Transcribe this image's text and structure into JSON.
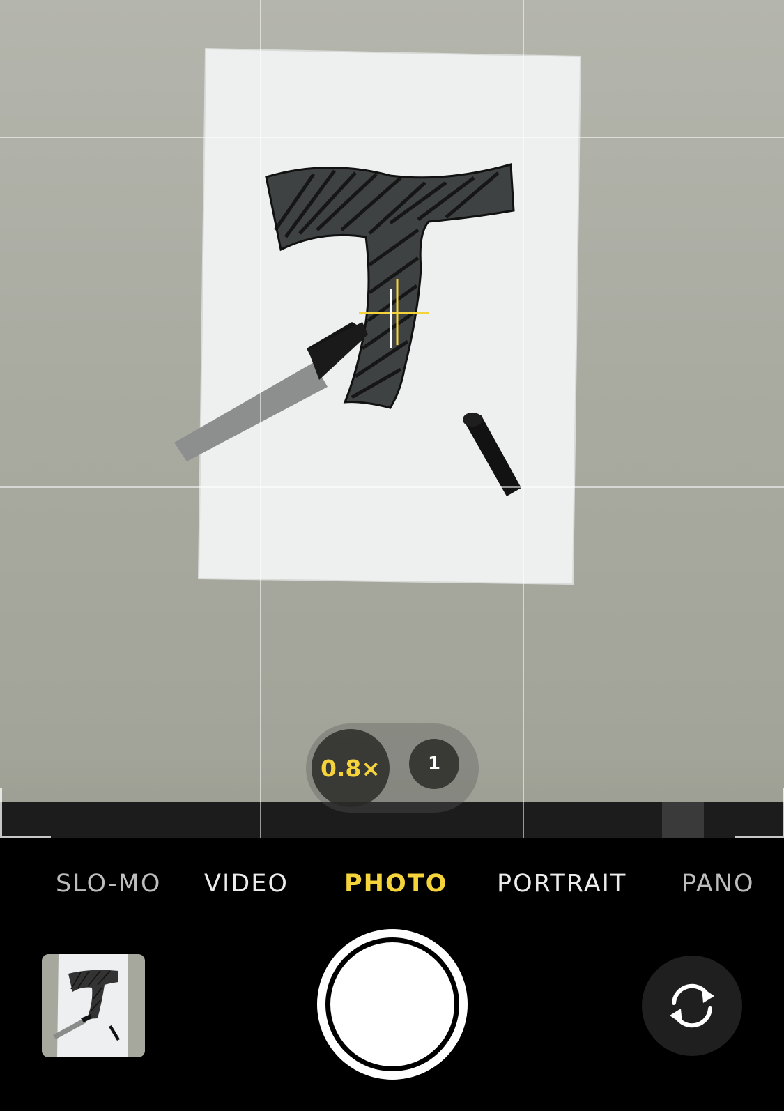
{
  "camera": {
    "zoom": {
      "options": [
        "0.8×",
        "1"
      ],
      "selected": "0.8×"
    },
    "modes": {
      "partial_left": "",
      "slo_mo": "SLO-MO",
      "video": "VIDEO",
      "photo": "PHOTO",
      "portrait": "PORTRAIT",
      "pano": "PANO",
      "selected": "PHOTO"
    },
    "controls": {
      "shutter": "shutter-button",
      "flip": "camera-flip-icon",
      "thumbnail": "last-photo-thumbnail"
    },
    "colors": {
      "accent_yellow": "#f5d33a",
      "background": "#000000",
      "button_dark": "#1f1f1f"
    }
  }
}
